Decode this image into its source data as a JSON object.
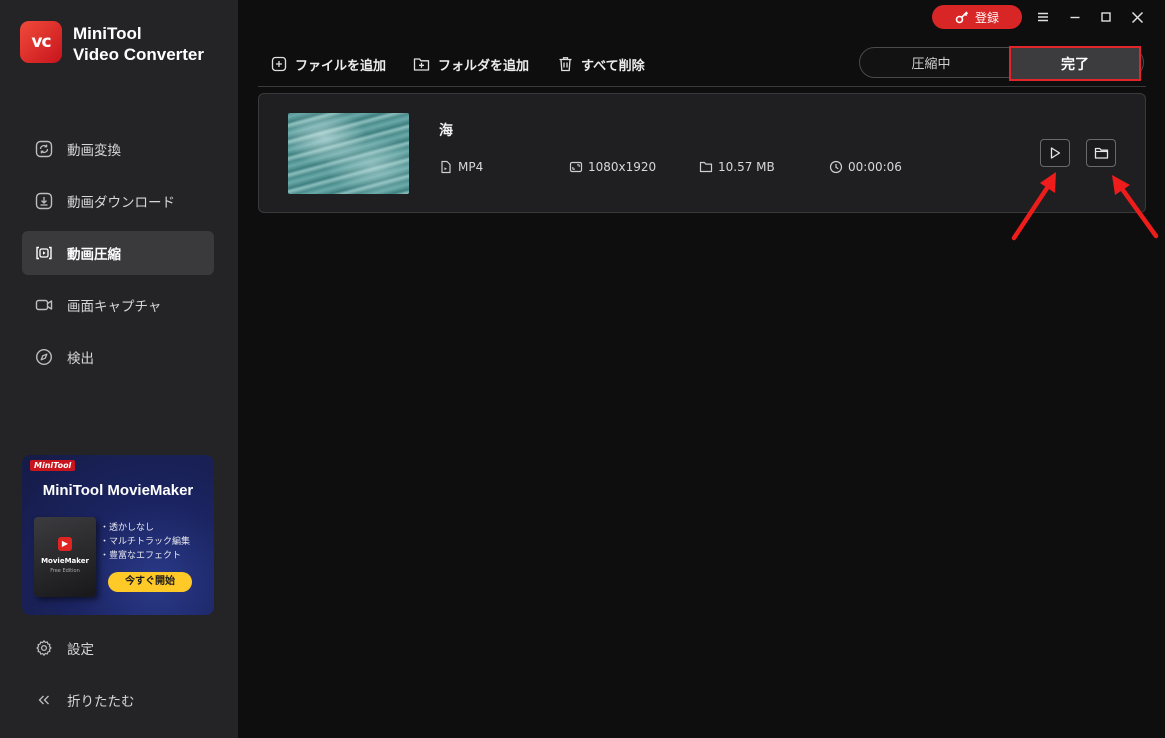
{
  "app": {
    "logo_text": "vc",
    "name_line1": "MiniTool",
    "name_line2": "Video Converter"
  },
  "sidebar": {
    "items": [
      {
        "label": "動画変換",
        "icon": "convert-icon"
      },
      {
        "label": "動画ダウンロード",
        "icon": "download-icon"
      },
      {
        "label": "動画圧縮",
        "icon": "compress-icon",
        "active": true
      },
      {
        "label": "画面キャプチャ",
        "icon": "camera-icon"
      },
      {
        "label": "検出",
        "icon": "compass-icon"
      }
    ],
    "settings_label": "設定",
    "collapse_label": "折りたたむ"
  },
  "promo": {
    "badge": "MiniTool",
    "title": "MiniTool MovieMaker",
    "box_name": "MovieMaker",
    "box_edition": "Free Edition",
    "features": [
      "・透かしなし",
      "・マルチトラック編集",
      "・豊富なエフェクト"
    ],
    "cta": "今すぐ開始"
  },
  "window": {
    "register_label": "登録"
  },
  "toolbar": {
    "add_file": "ファイルを追加",
    "add_folder": "フォルダを追加",
    "delete_all": "すべて削除"
  },
  "tabs": {
    "compressing": "圧縮中",
    "done": "完了"
  },
  "file": {
    "name": "海",
    "format": "MP4",
    "resolution": "1080x1920",
    "size": "10.57 MB",
    "duration": "00:00:06"
  },
  "colors": {
    "accent_red": "#d82626",
    "promo_cta": "#ffc928",
    "highlight_border": "#e0262b"
  }
}
